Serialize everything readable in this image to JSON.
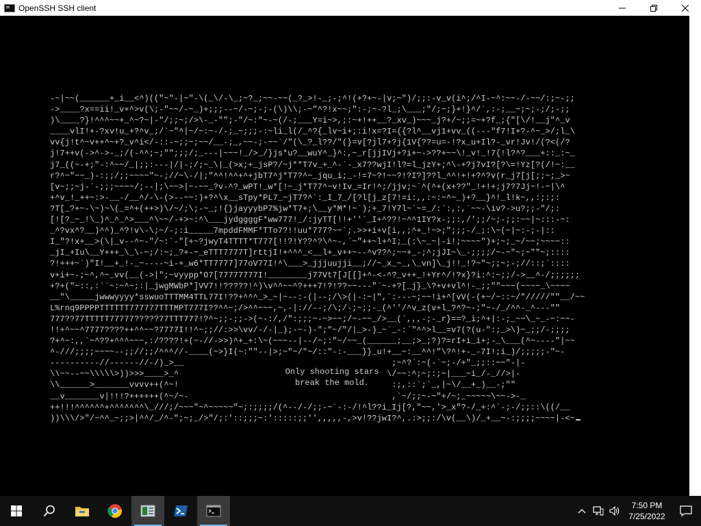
{
  "window": {
    "title": "OpenSSH SSH client",
    "icons": {
      "app": "console-icon",
      "minimize": "minimize-icon",
      "maximize": "restore-icon",
      "close": "close-icon"
    }
  },
  "console": {
    "lines": [
      "-~|~~(______+_i__<^)((\"~\"-|~\"-\\(_\\/-\\_;~?_;~~-~~(_?_>!-_;-;^!(+?+~-|v;~\")/;;:-v_v(i^;/^I-~^:~~-/-~~/:;~-;;",
      "->____?x==ii!_v+^>v(\\;-\"~~/-~_)+;;;--~/-~;-;-(\\)\\\\;-~\"^?!x~~;\":-;~-?l_;\\___;\"/;~;}+!}^/`,:-;__~;~;-;/;-;;",
      ")\\____?}!^^^~~+_^~?~|-\"/;;~;/>\\-_-\"\";-\"/~:\"~-~(/-;___Y=i~>,;:~+!++__?_xv_)~~~_j?+/~;;=~+?f_;{\"[\\/!__j\"^_v",
      "____vlI!+-?xv!u_+?^v_;/`~\"^|~/~:~-/-;_~;;;-:~li_l(/_^?{_lv~i+;:i!x=?I={{?l^__vj1+vv_((---\"f7!I+?-^~_>/;l_\\",
      "vv{j!t^~v++^~+?_v^i</-::-~;;~;~~/__-;_,~~-;-~~`/\"(\\_?_l??/\"(}=v[?jl7+?j{1V{??=u=-!?x_u+Il?-_vr!Jv!/(?<(/?",
      "j!7++v(->^->-_;/(-^^;~;\"\";;;/;_---|~~~!_/>_/}js*u?__wuY^_}^:,~_r[jjIVj+?i+~->??+~~\\!_v!_!7{!l?^?___+::_:~_",
      "j7_((~-+;\"-:^~~/_|;;:---|/|-;/;~_\\|_(>x;+_jsP?/~j**T7v_+_^-`-_x7??wjI!l?=l_jzY+;^\\-+?j7vI?[?\\=!Yz[?(/!~:__",
      "r?^~\"~~_)-:;;/;;~~~~\"~-;//~\\-/|;\"^^!^^+^+jbT7^j*T7?^~_jqu_i;_-!=7~?!~~?!?I?]??l_^^!+!+?^?v(r_j7[j[;;~;_>~",
      "[v~;;~j-`-;;;~~~~/;--|;\\~~>|~-~~_?v-^?_wPT!_w*[!~_j*T77^~v!Iv_=Ir!^;/jjv;~`^(^+(x+??\"_!+!+;j7?7Jj~!-~|\\^",
      "+^v_!_++~:>-__-/__^/-\\-(>--~~:)+?^\\x__sTpy*PL7_~jT7?^`:_I_7_/[?l[j_z[7!=i:,,:~:~^~_)+?__}^!_l!k~,,:;:;:",
      "?T[_?+~-\\~)~\\(_=^+(++>)\\/~/;\\;-~_;!{}jayyybP7%jw*T7+;\\__y*M*!~`);+_7!Y7l~`~=_/:`:,:,`~~-\\iv?->u?;;-\"/;:",
      "[![?_~_!\\_)^_^_^>___^\\~~/-+>~:^\\___jydggggF*ww777!_/:jyTT[!!+''`_I+^??!~^^1IY?x-;;:,/';;/~;-;;:~~|~:::-~:",
      "_^?vx^?__)^^)_^?!v\\-\\;~/-;:i_____7mpddFMMF*TTo7?!!uu*777?~~`;.>>+i+v[i,,;^+_!~>;\";;;-/_;:\\~(~|~:-;-|::",
      "I_\"?!x+__>(\\|_v--^~-\"/~:`-\"[+~?jwyT4TTTT*T777[!!?!Y??^?\\^~-,`~\"++~l+^I;_(:\\~_~|-i!;~~~~\")+;~;_~/~~;~~~~::",
      "_jI_+Iu\\__Y+++_\\_\\-~;/:~;_?+-~_eTTT7777T]rttjI!+^^^_<__l+_v++~--^v??^;~~+_-;^;jJI~\\_-;;;;/~-~\"~;~\"\"~;::::",
      "?!+++~`)\"I!__+_!-_~----~i-+_w6*TT7777]77oV77I!^\\___>_jjjuujji__;//~_x_~_,\\_vn]\\_j!!_!?~\"~;;~;-;//::;`::::",
      "v+i+~-;~^,^~_vv(__(->|\";~vyypp*O7[77777777I!________j77Vt7[J[[]+^-<-^?_v++_!+Yr^/!?x}?i:^:~;;/->__^-/;;;;;;",
      "+?+(\"~::,:``~:~^~;:|_jwgMWbP*]VV7!!?????!^)\\v^^~~^?+++7!?!??~~---\"`~-+?[_j}_\\?+v+vl^!-_;;\"\"~~~(~~~~_\\~~~~",
      "__\"\\_____jwwwyyyy*sswuoTTTMM4TTL77I!??+^^^_>_~|~--:-(|--;/\\>(|-:~|\",`:---~;~~!i+^[vV(-(+~/~::~/\"/////\"\"__/~~",
      "L%rnq9PPPPTTTTTT777777TTTMPT777I??^^~;/>^^~~~,~,-|://--;/\\;/-;~;;-_(^''/^v_z(v+l_?^?~-;\"~-/_/^^-_^---\"\"",
      "777??77TTTTT77777?????77TTT777!?^~;;-;;->(~-:/,/\":;;;~-~>~~;/~-~~_/>__(`,,,-;-_r}==?_i;^+|:-;_~~\\_~_-~:~~-",
      "!!+^~~^7777????++^^~~?7777I!!^~;;//:>>\\vv/-/-|_);-~-)-\";\"~/\"/|_>-)_~`_-:`\"^^>l__=v7(?(u-\":;_>\\)~_;;/-;;;;",
      "?+^~:,,`~^??+^^^~~~,:/????!+(~-//->>)^+_+:\\~(~~~--|--/~;:\"~/~~_(______;__;>_;?)?=rI+i_i+;-_\\___(^~----\"|~~",
      "^-///;;;;~~~~--;;//;;/^^^//-____(~>}I(~:\"\"--|>;~\"~/\"~/::\"-:-___}}_u!+__~:__^^!\"\\?^!+-_-7I!;i_)/;;;;;-\"~-",
      "----------//------//-/)_>__                                          ;~^?`:~(-`~;-/+\"_;;::~~\"-|-",
      "\\\\~~--~~\\\\\\\\\\>))>>>____>_^                                          \\/~~:^;~;:;~|___~i_/-_//>|-",
      "\\\\______>_______vvvv++(^~!                                           :;,::`;`_,|~\\/__+_)__-;\"\"",
      "__v_______v|!!!?++++++(^~/~-                                         ,`~/;;~-~\"+/~;_~~~~~\\~~->-_",
      "++!!!^^^^^^+^^^^^^^\\_///;/~~~\"~^~~~~~\"~;:;;;;/(^--/-/;;-~`-:-/!^l??i_Ij[?,\"~~,'>_x\"?-/_+:^`-;-/;;::\\((/__",
      "))\\\\\\/>\"/~^^_~;;>|^^/_/^-\";~;_/>\"/;:'::;;;~:':::::;;'',,,,,-,>v!??jwI?^,.:>;;:/\\v(__\\)/_+__~-:;;;;~~~~|-<~"
    ],
    "caption_line1": "Only shooting stars",
    "caption_line2": "break the mold."
  },
  "taskbar": {
    "items": [
      {
        "name": "start-button",
        "icon": "windows-logo-icon"
      },
      {
        "name": "search-button",
        "icon": "search-icon"
      },
      {
        "name": "file-explorer-button",
        "icon": "folder-icon"
      },
      {
        "name": "chrome-button",
        "icon": "chrome-icon"
      },
      {
        "name": "server-manager-button",
        "icon": "server-manager-icon"
      },
      {
        "name": "powershell-button",
        "icon": "powershell-icon"
      },
      {
        "name": "ssh-console-button",
        "icon": "console-icon"
      }
    ],
    "clock": {
      "time": "7:50 PM",
      "date": "7/25/2022"
    },
    "tray_icons": [
      "chevron-up-icon",
      "network-icon",
      "volume-icon",
      "notification-icon"
    ]
  }
}
